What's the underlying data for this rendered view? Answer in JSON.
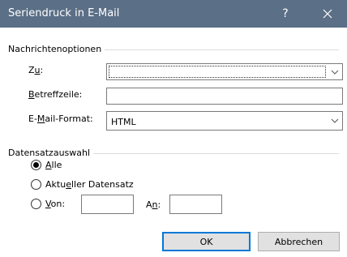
{
  "dialog": {
    "title": "Seriendruck in E-Mail",
    "help_label": "?"
  },
  "message_options": {
    "group_label": "Nachrichtenoptionen",
    "to": {
      "label_prefix": "Z",
      "label_mnemonic": "u",
      "label_suffix": ":",
      "value": ""
    },
    "subject": {
      "label_mnemonic": "B",
      "label_rest": "etreffzeile:",
      "value": ""
    },
    "format": {
      "label_prefix": "E-",
      "label_mnemonic": "M",
      "label_suffix": "ail-Format:",
      "value": "HTML"
    }
  },
  "record_selection": {
    "group_label": "Datensatzauswahl",
    "all": {
      "label_mnemonic": "A",
      "label_rest": "lle",
      "checked": true
    },
    "current": {
      "label_prefix": "Aktu",
      "label_mnemonic": "e",
      "label_suffix": "ller Datensatz",
      "checked": false
    },
    "range": {
      "from_mnemonic": "V",
      "from_rest": "on:",
      "to_prefix": "A",
      "to_mnemonic": "n",
      "to_suffix": ":",
      "from_value": "",
      "to_value": "",
      "checked": false
    }
  },
  "buttons": {
    "ok": "OK",
    "cancel": "Abbrechen"
  },
  "colors": {
    "titlebar": "#5b6f86",
    "focus_border": "#0078d7"
  }
}
